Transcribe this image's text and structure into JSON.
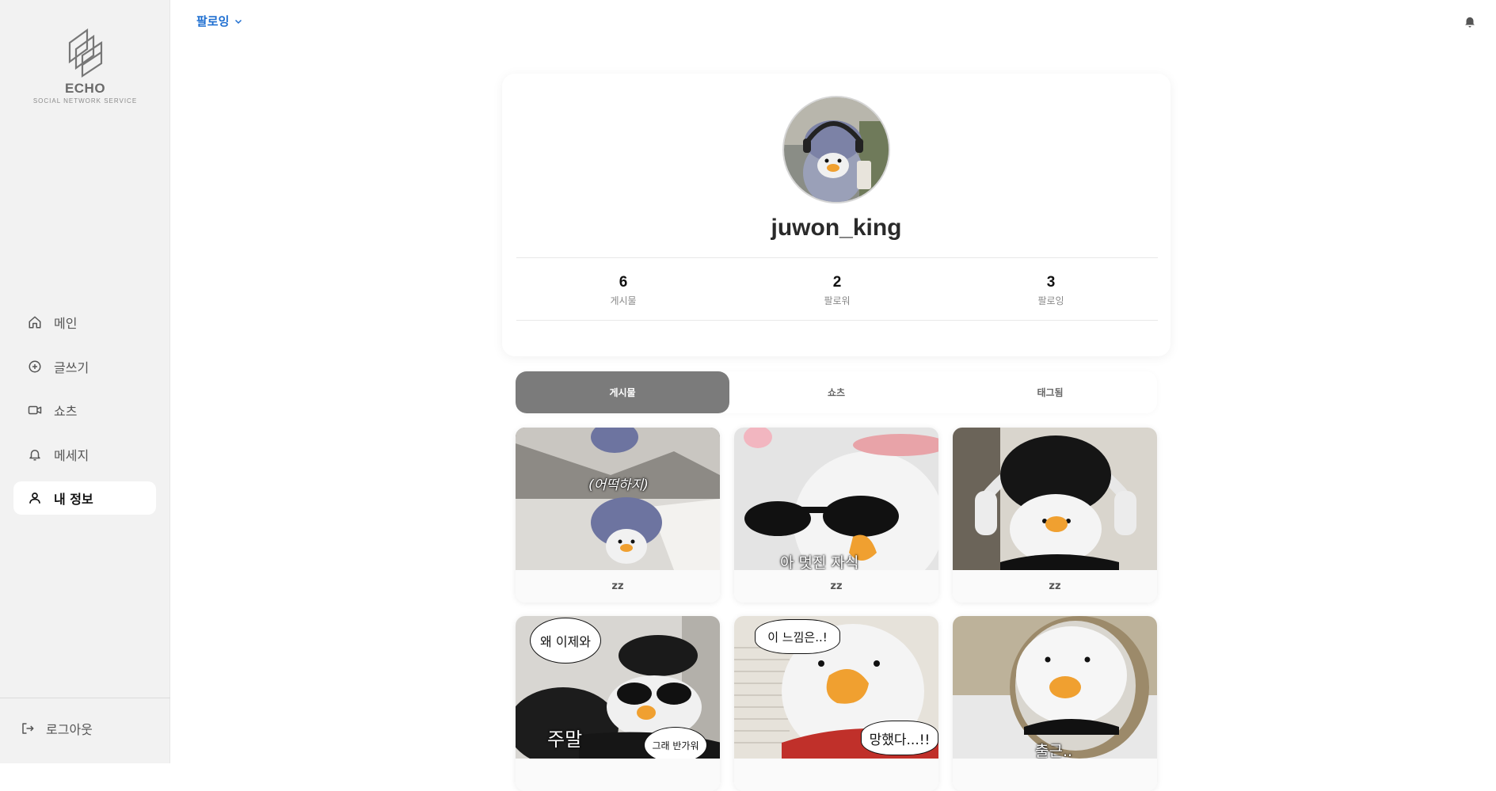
{
  "brand": {
    "name": "ECHO",
    "tagline": "SOCIAL NETWORK SERVICE"
  },
  "sidebar": {
    "items": [
      {
        "label": "메인",
        "icon": "home-icon"
      },
      {
        "label": "글쓰기",
        "icon": "plus-circle-icon"
      },
      {
        "label": "쇼츠",
        "icon": "video-icon"
      },
      {
        "label": "메세지",
        "icon": "bell-icon"
      },
      {
        "label": "내 정보",
        "icon": "user-icon",
        "active": true
      }
    ],
    "logout_label": "로그아웃"
  },
  "topbar": {
    "filter_label": "팔로잉"
  },
  "profile": {
    "username": "juwon_king",
    "stats": [
      {
        "value": "6",
        "label": "게시물"
      },
      {
        "value": "2",
        "label": "팔로워"
      },
      {
        "value": "3",
        "label": "팔로잉"
      }
    ]
  },
  "tabs": [
    {
      "label": "게시물",
      "active": true
    },
    {
      "label": "쇼츠"
    },
    {
      "label": "태그됨"
    }
  ],
  "posts": [
    {
      "caption": "zz",
      "overlay": "(어떡하지)"
    },
    {
      "caption": "zz",
      "overlay": "아 멋진 자식"
    },
    {
      "caption": "zz",
      "overlay": ""
    },
    {
      "caption": "",
      "overlay": "주말",
      "bubble1": "왜 이제와",
      "bubble2": "그래 반가워"
    },
    {
      "caption": "",
      "bubble1": "이 느낌은..!",
      "bubble2": "망했다...!!"
    },
    {
      "caption": "",
      "overlay": "출근.."
    }
  ],
  "colors": {
    "accent": "#1f6fd1",
    "active_tab": "#7b7b7b",
    "sidebar_bg": "#f2f2f2"
  }
}
